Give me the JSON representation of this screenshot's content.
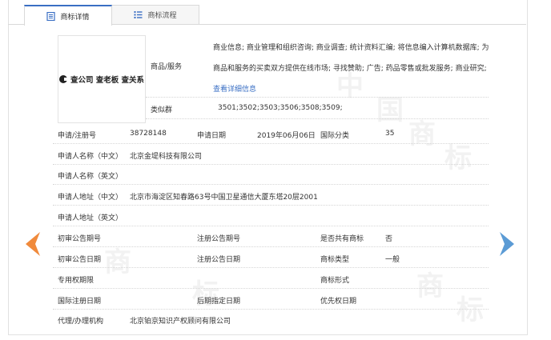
{
  "tabs": [
    {
      "label": "商标详情",
      "icon": "document-icon",
      "active": true
    },
    {
      "label": "商标流程",
      "icon": "list-icon",
      "active": false
    }
  ],
  "logo": {
    "text": "查公司 查老板 查关系"
  },
  "goods": {
    "label": "商品/服务",
    "text": "商业信息; 商业管理和组织咨询; 商业调查; 统计资料汇编; 将信息编入计算机数据库; 为商品和服务的买卖双方提供在线市场; 寻找赞助; 广告; 药品零售或批发服务; 商业研究; ",
    "link": "查看详细信息"
  },
  "similar": {
    "label": "类似群",
    "value": "3501;3502;3503;3506;3508;3509;"
  },
  "fields": {
    "reg_no_label": "申请/注册号",
    "reg_no": "38728148",
    "apply_date_label": "申请日期",
    "apply_date": "2019年06月06日",
    "intl_class_label": "国际分类",
    "intl_class": "35",
    "applicant_cn_label": "申请人名称（中文）",
    "applicant_cn": "北京金堤科技有限公司",
    "applicant_en_label": "申请人名称（英文）",
    "address_cn_label": "申请人地址（中文）",
    "address_cn": "北京市海淀区知春路63号中国卫星通信大厦东塔20层2001",
    "address_en_label": "申请人地址（英文）",
    "prelim_no_label": "初审公告期号",
    "reg_pub_no_label": "注册公告期号",
    "shared_label": "是否共有商标",
    "shared": "否",
    "prelim_date_label": "初审公告日期",
    "reg_pub_date_label": "注册公告日期",
    "type_label": "商标类型",
    "type": "一般",
    "exclusive_label": "专用权期限",
    "form_label": "商标形式",
    "intl_reg_date_label": "国际注册日期",
    "later_date_label": "后期指定日期",
    "priority_label": "优先权日期",
    "agent_label": "代理/办理机构",
    "agent": "北京铂京知识产权顾问有限公司"
  },
  "colors": {
    "prev_arrow": "#f08a3c",
    "next_arrow": "#5b9bd5",
    "accent": "#3a6fc4"
  }
}
